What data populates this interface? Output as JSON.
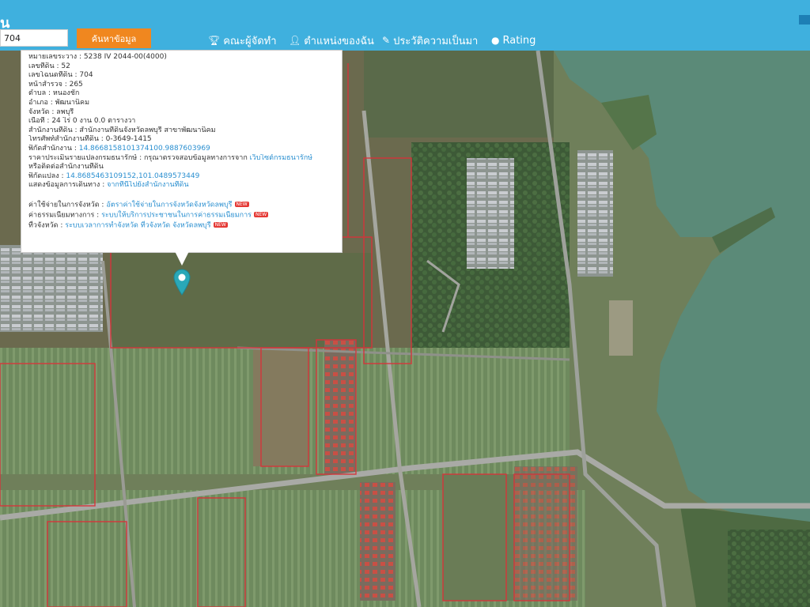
{
  "header": {
    "logo_text": "น",
    "search_value": "704",
    "search_button": "ค้นหาข้อมูล",
    "nav": [
      {
        "label": "คณะผู้จัดทำ",
        "icon": "trophy-icon"
      },
      {
        "label": "ตำแหน่งของฉัน",
        "icon": "user-icon"
      },
      {
        "label": "ประวัติความเป็นมา",
        "icon": "book-icon"
      },
      {
        "label": "Rating",
        "icon": "comment-icon"
      }
    ]
  },
  "popup": {
    "sheet_no": "หมายเลขระวาง : 5238 IV 2044-00(4000)",
    "parcel_no": "เลขที่ดิน : 52",
    "deed_no": "เลขโฉนดที่ดิน : 704",
    "survey_page": "หน้าสำรวจ : 265",
    "subdistrict": "ตำบล : หนองชัก",
    "district": "อำเภอ : พัฒนานิคม",
    "province": "จังหวัด : ลพบุรี",
    "area": "เนื้อที่ : 24 ไร่ 0 งาน 0.0 ตารางวา",
    "land_office": "สำนักงานที่ดิน : สำนักงานที่ดินจังหวัดลพบุรี สาขาพัฒนานิคม",
    "phone": "โทรศัพท์สำนักงานที่ดิน : 0-3649-1415",
    "office_coord_label": "พิกัดสำนักงาน : ",
    "office_coord_value": "14.8668158101374100.9887603969",
    "appraisal_label": "ราคาประเมินรายแปลงกรมธนารักษ์ : กรุณาตรวจสอบข้อมูลทางการจาก ",
    "appraisal_link": "เว็บไซต์กรมธนารักษ์",
    "appraisal_cont": "หรือติดต่อสำนักงานที่ดิน",
    "parcel_coord_label": "พิกัดแปลง : ",
    "parcel_coord_value": "14.8685463109152,101.0489573449",
    "show_info_label": "แสดงข้อมูลการเดินทาง : ",
    "show_info_link": "จากที่นี่ไปยังสำนักงานที่ดิน",
    "links": [
      {
        "label": "ค่าใช้จ่ายในการจังหวัด : ",
        "link": "อัตราค่าใช้จ่ายในการจังหวัดจังหวัดลพบุรี",
        "badge": "NEW"
      },
      {
        "label": "ค่าธรรมเนียมทางการ : ",
        "link": "ระบบให้บริการประชาชนในการค่าธรรมเนียมการ",
        "badge": "NEW"
      },
      {
        "label": "ที่วจังหวัด : ",
        "link": "ระบบเวลาการทำจังหวัด ที่วจังหวัด จังหวัดลพบุรี",
        "badge": "NEW"
      }
    ]
  },
  "colors": {
    "header_bg": "#3fb0de",
    "search_button_bg": "#f0871f",
    "link": "#2a8fd0",
    "badge": "#e53935",
    "pin": "#2aa8b8",
    "water": "#5b8a78",
    "parcel_border": "#d8333a"
  }
}
